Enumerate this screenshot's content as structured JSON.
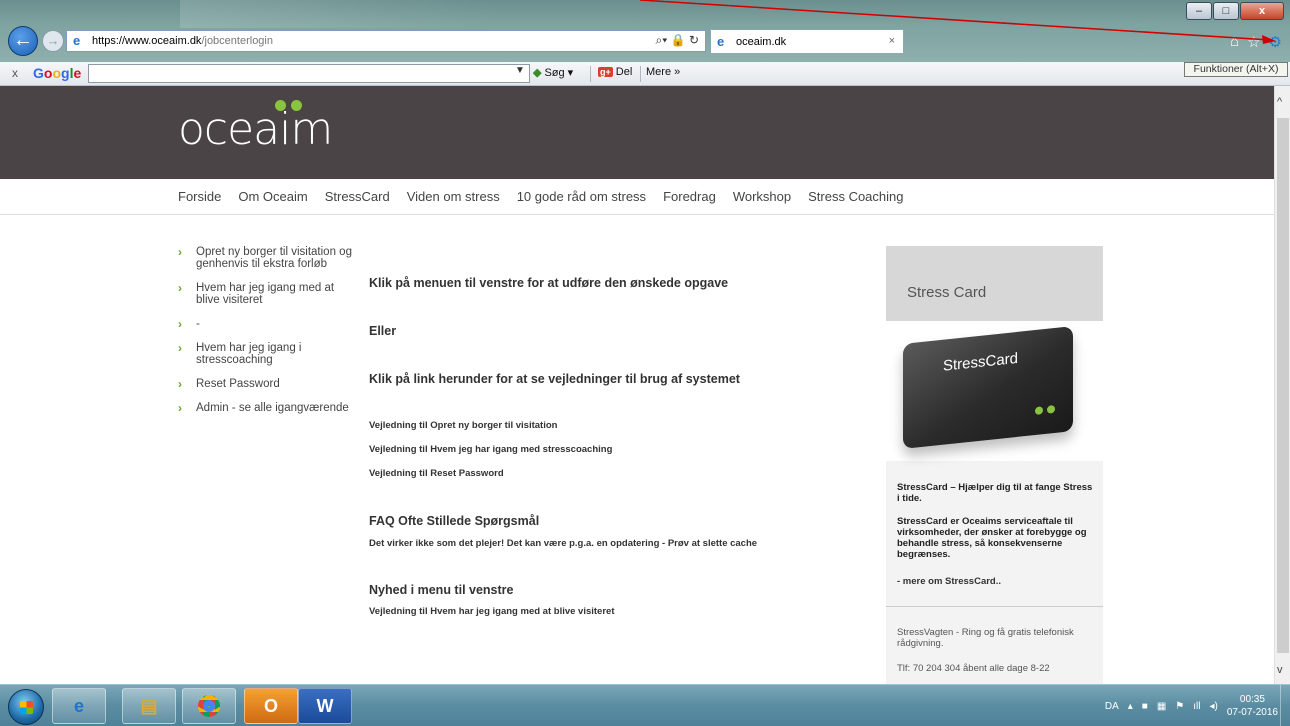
{
  "browser": {
    "url_host": "https://www.oceaim.dk",
    "url_path": "/jobcenterlogin",
    "tab_title": "oceaim.dk",
    "tab_close": "×",
    "tooltip": "Funktioner (Alt+X)"
  },
  "google_toolbar": {
    "close": "x",
    "logo": {
      "g": "G",
      "o1": "o",
      "o2": "o",
      "g2": "g",
      "l": "l",
      "e": "e"
    },
    "search_button": "Søg",
    "share_button": "Del",
    "more_button": "Mere »"
  },
  "site": {
    "logo_text": "oceaim",
    "nav": [
      "Forside",
      "Om Oceaim",
      "StressCard",
      "Viden om stress",
      "10 gode råd om stress",
      "Foredrag",
      "Workshop",
      "Stress Coaching"
    ],
    "side_menu": [
      "Opret ny borger til visitation og genhenvis til ekstra forløb",
      "Hvem har jeg igang med at blive visiteret",
      "-",
      "Hvem har jeg igang i stresscoaching",
      "Reset Password",
      "Admin - se alle igangværende"
    ],
    "content": {
      "heading1": "Klik på menuen til venstre for at udføre den ønskede opgave",
      "eller": "Eller",
      "heading2": "Klik på link herunder for at se vejledninger til brug af systemet",
      "guides": [
        "Vejledning til Opret ny borger til visitation",
        "Vejledning til Hvem jeg har igang med stresscoaching",
        "Vejledning til Reset Password"
      ],
      "faq_title": "FAQ Ofte Stillede Spørgsmål",
      "faq_text": "Det virker ikke som det plejer! Det kan være p.g.a. en opdatering - Prøv at slette cache",
      "news_title": "Nyhed i menu til venstre",
      "news_link": "Vejledning til Hvem har jeg igang med at blive visiteret"
    },
    "sidebar": {
      "title": "Stress Card",
      "card_label": "StressCard",
      "text1": "StressCard – Hjælper dig til at fange Stress i tide.",
      "text2": "StressCard er Oceaims serviceaftale til virksomheder, der ønsker at forebygge og behandle stress, så konsekvenserne begrænses.",
      "more": "- mere om StressCard..",
      "vagten": "StressVagten - Ring og få gratis telefonisk rådgivning.",
      "phone": "Tlf: 70 204 304 åbent alle dage 8-22"
    }
  },
  "taskbar": {
    "language": "DA",
    "time": "00:35",
    "date": "07-07-2016"
  },
  "colors": {
    "header_bg": "#4a4446",
    "logo_dots": "#8ac43f",
    "sidebar_head": "#d7d7d7",
    "annotation_arrow": "#d00000"
  }
}
